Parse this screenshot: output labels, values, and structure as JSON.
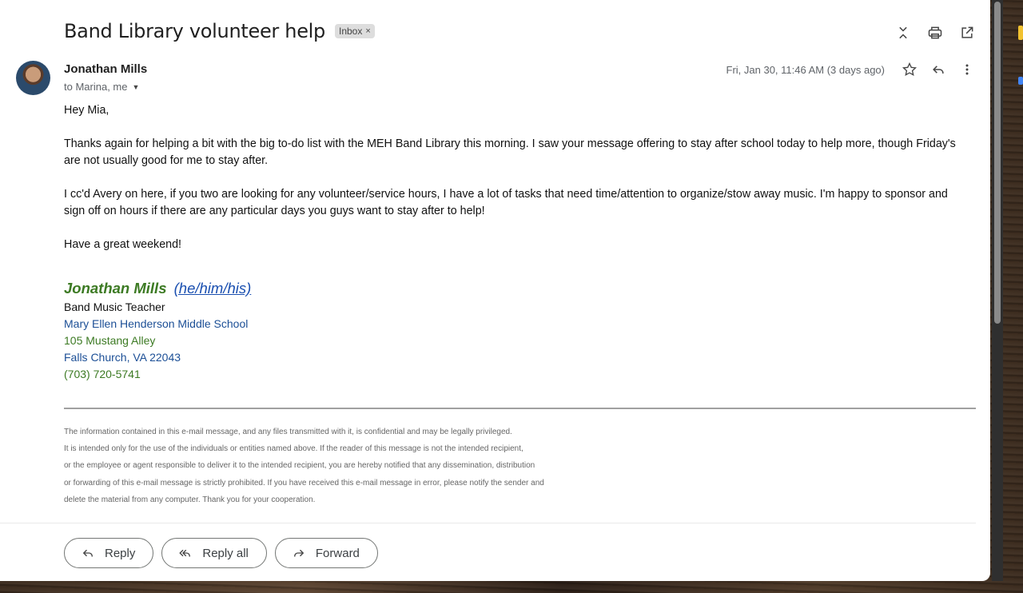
{
  "email": {
    "subject": "Band Library volunteer help",
    "label": "Inbox",
    "label_remove": "×",
    "sender_name": "Jonathan Mills",
    "recipients": "to Marina, me",
    "timestamp": "Fri, Jan 30, 11:46 AM (3 days ago)",
    "body": [
      "Hey Mia,",
      "Thanks again for helping a bit with the big to-do list with the MEH Band Library this morning.  I saw your message offering to stay after school today to help more, though Friday's are not usually good for me to stay after.",
      "I cc'd Avery on here, if you two are looking for any volunteer/service hours, I have a lot of tasks that need time/attention to organize/stow away music.  I'm happy to sponsor and sign off on hours if there are any particular days you guys want to stay after to help!",
      "Have a great weekend!"
    ],
    "signature": {
      "name": "Jonathan Mills",
      "pronouns": "(he/him/his)",
      "title": "Band Music Teacher",
      "school": "Mary Ellen Henderson Middle School",
      "street": "105 Mustang Alley",
      "city": "Falls Church, VA 22043",
      "phone": "(703) 720-5741"
    },
    "disclaimer": [
      "The information contained in this e-mail message, and any files transmitted with it, is confidential and may be legally privileged.",
      "It is intended only for the use of the individuals or entities named above. If the reader of this message is not the intended recipient,",
      "or the employee or agent responsible to deliver it to the intended recipient, you are hereby notified that any dissemination, distribution",
      "or forwarding of this e-mail message is strictly prohibited. If you have received this e-mail message in error, please notify the sender and",
      "delete the material from any computer. Thank you for your cooperation."
    ]
  },
  "actions": {
    "reply": "Reply",
    "reply_all": "Reply all",
    "forward": "Forward"
  },
  "icons": {
    "collapse": "collapse-all-icon",
    "print": "print-icon",
    "open_new_window": "open-in-new-window-icon",
    "star": "star-icon",
    "reply": "reply-icon",
    "more": "more-vert-icon"
  },
  "colors": {
    "signature_green": "#3c7a23",
    "signature_blue": "#1c4f96",
    "link_blue": "#1a4fb0"
  }
}
